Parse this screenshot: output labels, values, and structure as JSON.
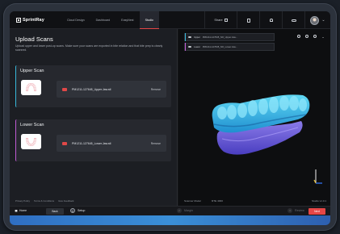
{
  "app": {
    "brand": "SprintRay",
    "nav_tabs": [
      {
        "label": "Cloud Design"
      },
      {
        "label": "Dashboard"
      },
      {
        "label": "EasyNest"
      },
      {
        "label": "Studio"
      }
    ],
    "share_label": "Share",
    "icons": [
      "document-icon",
      "bell-icon",
      "cloud-icon"
    ]
  },
  "left": {
    "title": "Upload Scans",
    "subtitle": "Upload upper and lower post-op scans. Make sure your scans are exported in bite relation and that bite prep is clearly scanned.",
    "upper": {
      "title": "Upper Scan",
      "file": "PM1211-127645_Upper.Jaw.stl",
      "remove": "Remove",
      "accent": "#38b7d9"
    },
    "lower": {
      "title": "Lower Scan",
      "file": "PM1211-127645_Lower.Jaw.stl",
      "remove": "Remove",
      "accent": "#c05bd4"
    },
    "footer_links": [
      "Privacy Policy",
      "Terms & Conditions",
      "Give Feedback"
    ]
  },
  "viewport": {
    "layers": [
      {
        "label": "Upper",
        "file": "PM1211-127645_NO_Upper.Jaw...",
        "color": "#38b7d9"
      },
      {
        "label": "Lower",
        "file": "PM1211-127645_NO_Lower.Jaw...",
        "color": "#c05bd4"
      }
    ],
    "scanner_label": "Scanner Model",
    "scanner_value": "3ITE 4000",
    "mode_label": "Studio v1.0.1"
  },
  "bottom": {
    "home_label": "Home",
    "back_label": "Back",
    "steps": [
      {
        "num": "1",
        "label": "Setup"
      },
      {
        "num": "2",
        "label": "Margin"
      },
      {
        "num": "3",
        "label": "Review"
      }
    ],
    "next_label": "Next"
  }
}
